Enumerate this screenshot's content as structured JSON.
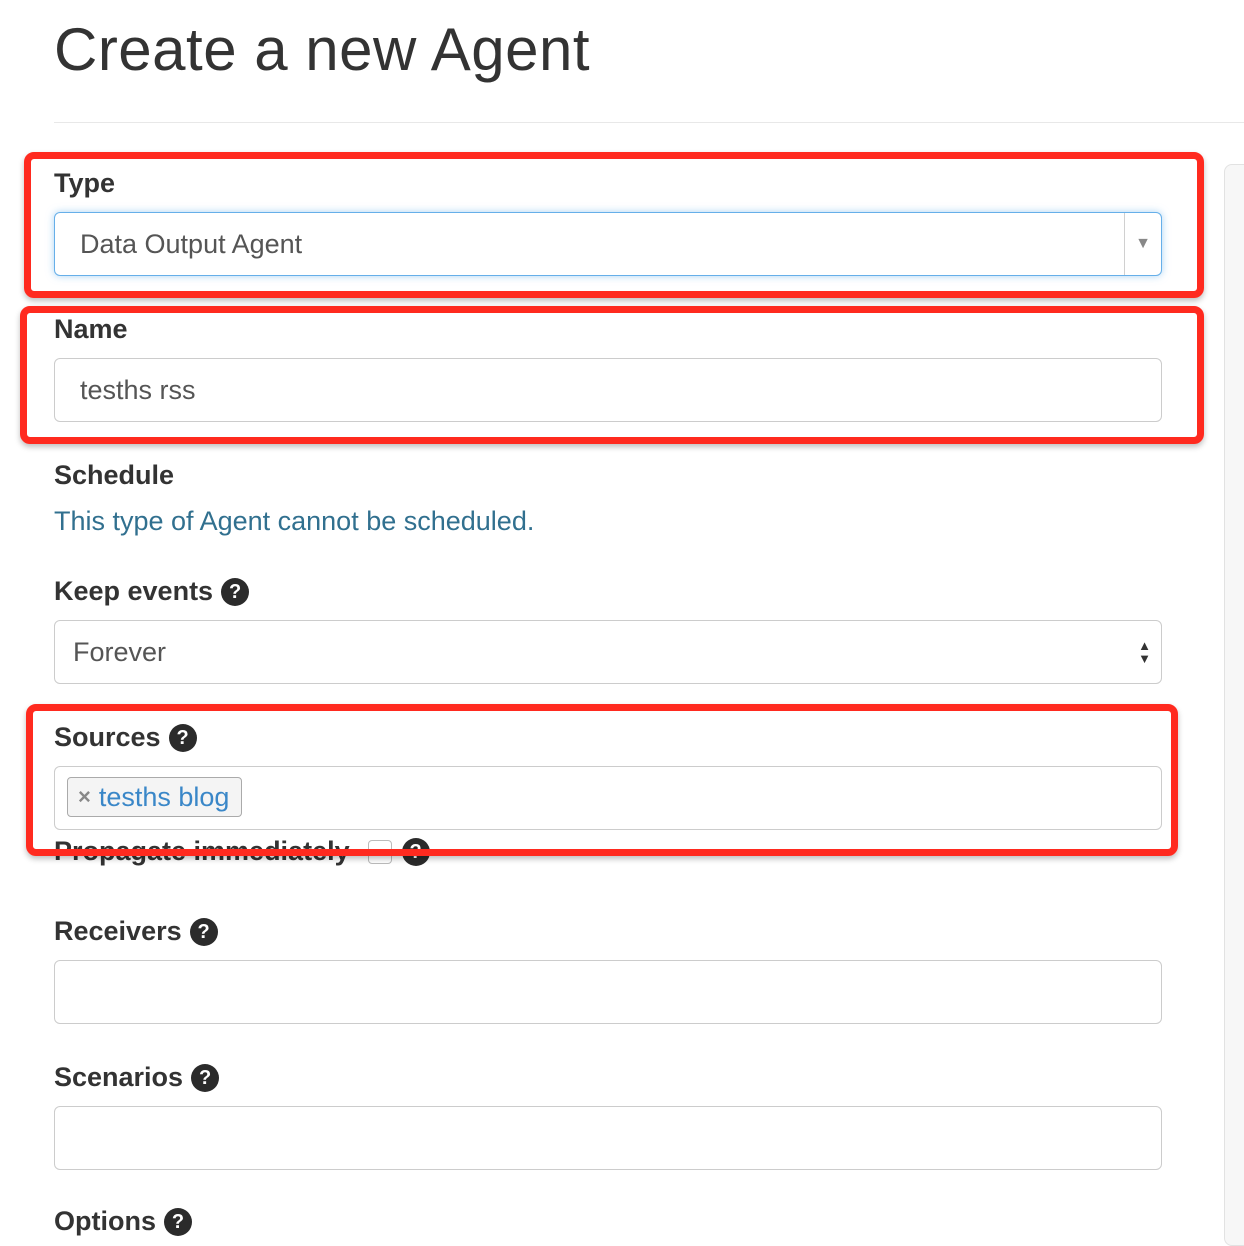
{
  "page": {
    "title": "Create a new Agent"
  },
  "type_field": {
    "label": "Type",
    "value": "Data Output Agent"
  },
  "name_field": {
    "label": "Name",
    "value": "tesths rss"
  },
  "schedule": {
    "label": "Schedule",
    "text": "This type of Agent cannot be scheduled."
  },
  "keep_events": {
    "label": "Keep events",
    "value": "Forever"
  },
  "sources": {
    "label": "Sources",
    "tags": [
      "tesths blog"
    ]
  },
  "propagate": {
    "label": "Propagate immediately"
  },
  "receivers": {
    "label": "Receivers",
    "value": ""
  },
  "scenarios": {
    "label": "Scenarios",
    "value": ""
  },
  "options": {
    "label": "Options"
  },
  "icons": {
    "help": "?",
    "remove": "×",
    "caret": "▼"
  },
  "colors": {
    "annotation": "#ff2a1f",
    "link_text": "#31708f",
    "tag_text": "#3a87c8",
    "focus": "#66afe9"
  }
}
